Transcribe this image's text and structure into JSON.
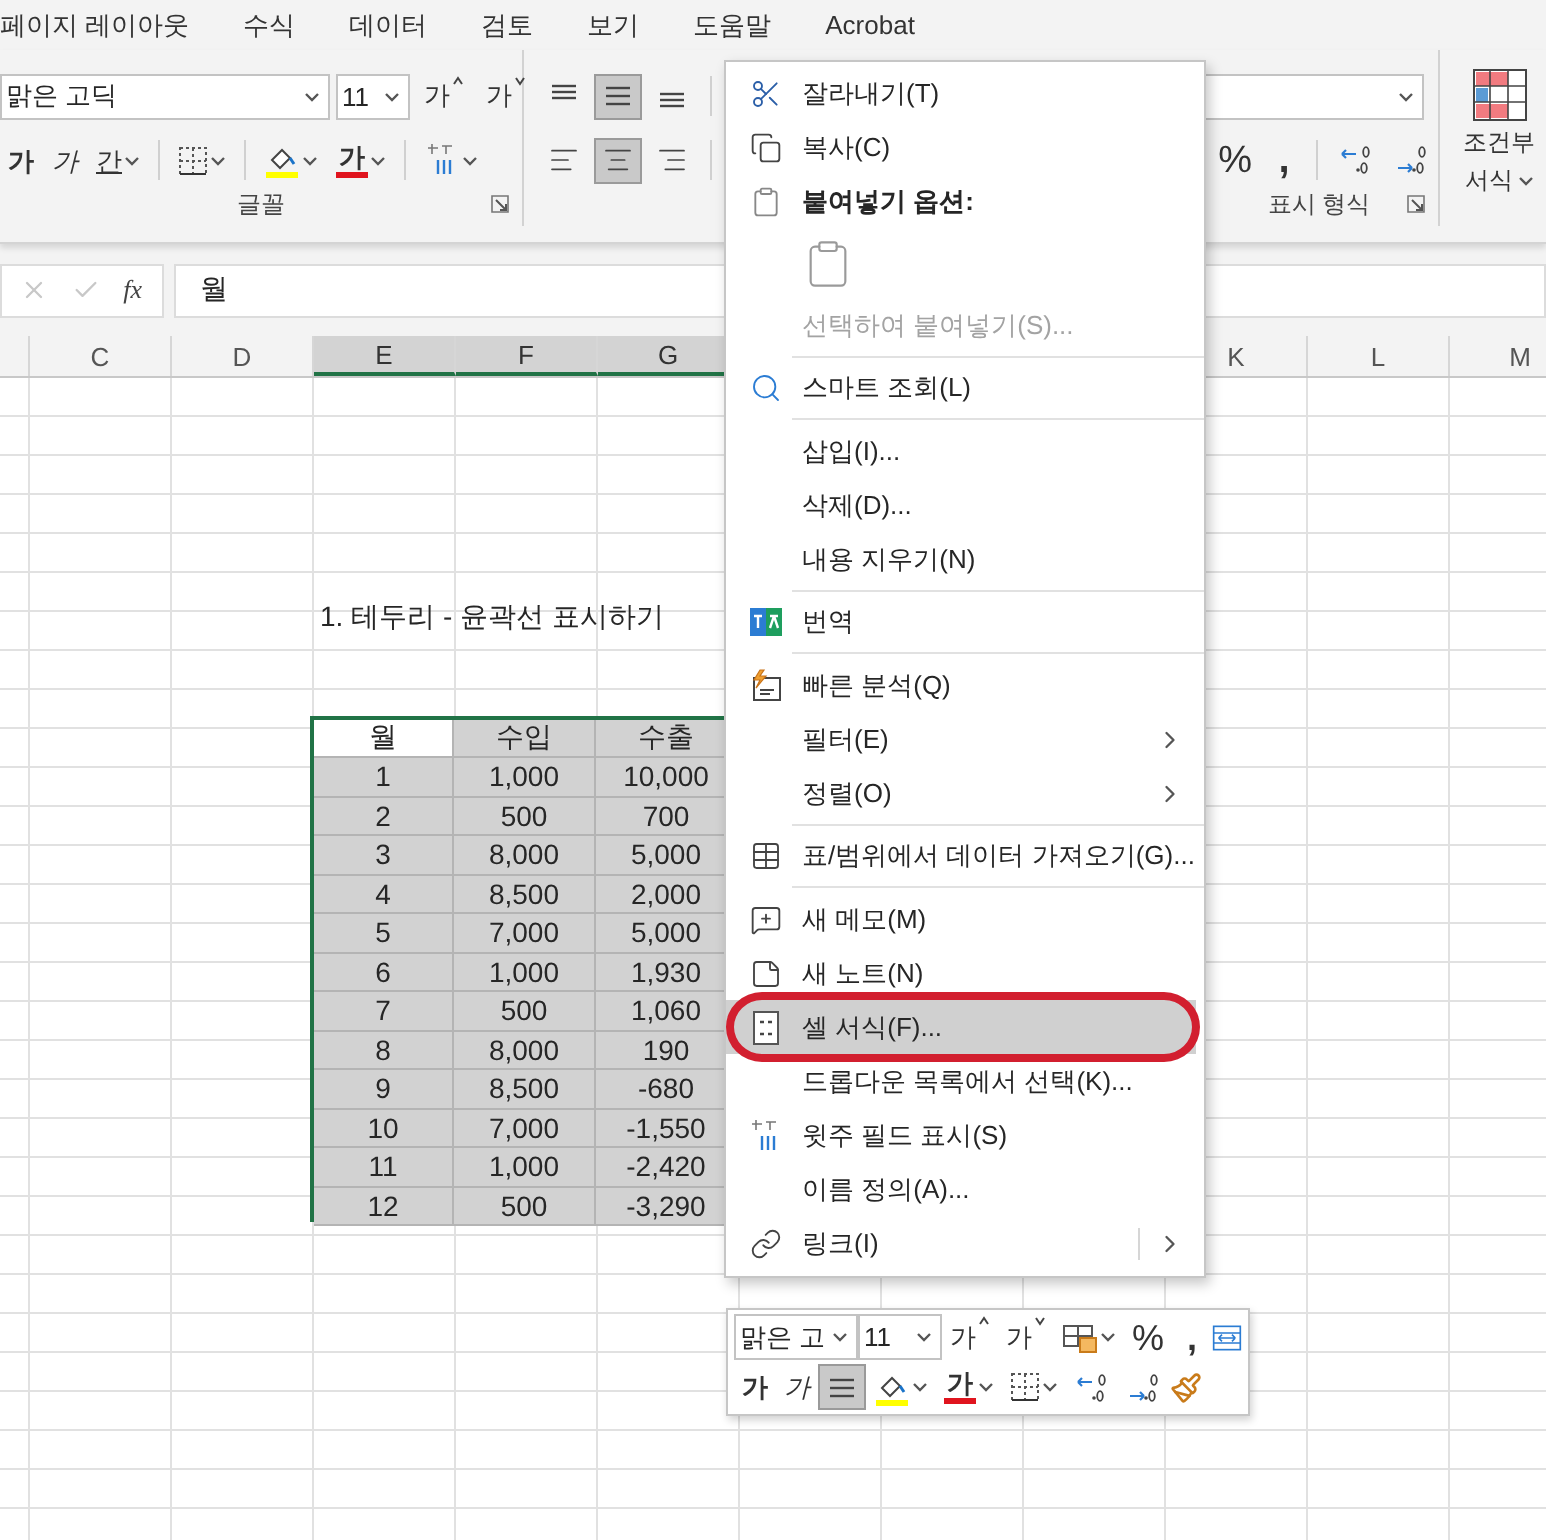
{
  "ribbon_tabs": [
    {
      "label": "페이지 레이아웃",
      "selected": false
    },
    {
      "label": "수식",
      "selected": false
    },
    {
      "label": "데이터",
      "selected": false
    },
    {
      "label": "검토",
      "selected": false
    },
    {
      "label": "보기",
      "selected": false
    },
    {
      "label": "도움말",
      "selected": false
    },
    {
      "label": "Acrobat",
      "selected": false
    }
  ],
  "font_group": {
    "label": "글꼴",
    "font_name": "맑은 고딕",
    "font_size": "11",
    "grow": "가",
    "shrink": "가",
    "bold": "가",
    "italic": "가",
    "underline": "간",
    "font_color": "가"
  },
  "alignment_group": {
    "vertical": [
      {
        "selected": false
      },
      {
        "selected": true
      },
      {
        "selected": false
      }
    ],
    "horizontal": [
      {
        "selected": false
      },
      {
        "selected": true
      },
      {
        "selected": false
      }
    ]
  },
  "number_group": {
    "label": "표시 형식",
    "percent": "%",
    "comma": ","
  },
  "conditional_format": {
    "label_line_1": "조건부",
    "label_line_2": "서식"
  },
  "formula_bar": {
    "function_label": "fx",
    "value": "월"
  },
  "columns": [
    {
      "label": "C",
      "selected": false
    },
    {
      "label": "D",
      "selected": false
    },
    {
      "label": "E",
      "selected": true
    },
    {
      "label": "F",
      "selected": true
    },
    {
      "label": "G",
      "selected": true
    },
    {
      "label": "K",
      "selected": false
    },
    {
      "label": "L",
      "selected": false
    },
    {
      "label": "M",
      "selected": false
    }
  ],
  "sheet_title": "1. 테두리 - 윤곽선 표시하기",
  "table": {
    "selected": true,
    "header": [
      {
        "text": "월",
        "active": true
      },
      {
        "text": "수입",
        "active": false
      },
      {
        "text": "수출",
        "active": false
      }
    ],
    "rows": [
      [
        "1",
        "1,000",
        "10,000"
      ],
      [
        "2",
        "500",
        "700"
      ],
      [
        "3",
        "8,000",
        "5,000"
      ],
      [
        "4",
        "8,500",
        "2,000"
      ],
      [
        "5",
        "7,000",
        "5,000"
      ],
      [
        "6",
        "1,000",
        "1,930"
      ],
      [
        "7",
        "500",
        "1,060"
      ],
      [
        "8",
        "8,000",
        "190"
      ],
      [
        "9",
        "8,500",
        "-680"
      ],
      [
        "10",
        "7,000",
        "-1,550"
      ],
      [
        "11",
        "1,000",
        "-2,420"
      ],
      [
        "12",
        "500",
        "-3,290"
      ]
    ]
  },
  "context_menu": [
    {
      "kind": "command",
      "label": "잘라내기(T)",
      "disabled": false,
      "highlighted": false,
      "circled": false,
      "submenu": false
    },
    {
      "kind": "command",
      "label": "복사(C)",
      "disabled": false,
      "highlighted": false,
      "circled": false,
      "submenu": false
    },
    {
      "kind": "heading",
      "label": "붙여넣기 옵션:"
    },
    {
      "kind": "paste-options"
    },
    {
      "kind": "command",
      "label": "선택하여 붙여넣기(S)...",
      "disabled": true,
      "highlighted": false,
      "circled": false,
      "submenu": false
    },
    {
      "kind": "separator"
    },
    {
      "kind": "command",
      "label": "스마트 조회(L)",
      "disabled": false,
      "highlighted": false,
      "circled": false,
      "submenu": false
    },
    {
      "kind": "separator"
    },
    {
      "kind": "command",
      "label": "삽입(I)...",
      "disabled": false,
      "highlighted": false,
      "circled": false,
      "submenu": false
    },
    {
      "kind": "command",
      "label": "삭제(D)...",
      "disabled": false,
      "highlighted": false,
      "circled": false,
      "submenu": false
    },
    {
      "kind": "command",
      "label": "내용 지우기(N)",
      "disabled": false,
      "highlighted": false,
      "circled": false,
      "submenu": false
    },
    {
      "kind": "separator"
    },
    {
      "kind": "command",
      "label": "번역",
      "disabled": false,
      "highlighted": false,
      "circled": false,
      "submenu": false
    },
    {
      "kind": "separator"
    },
    {
      "kind": "command",
      "label": "빠른 분석(Q)",
      "disabled": false,
      "highlighted": false,
      "circled": false,
      "submenu": false
    },
    {
      "kind": "command",
      "label": "필터(E)",
      "disabled": false,
      "highlighted": false,
      "circled": false,
      "submenu": true
    },
    {
      "kind": "command",
      "label": "정렬(O)",
      "disabled": false,
      "highlighted": false,
      "circled": false,
      "submenu": true
    },
    {
      "kind": "separator"
    },
    {
      "kind": "command",
      "label": "표/범위에서 데이터 가져오기(G)...",
      "disabled": false,
      "highlighted": false,
      "circled": false,
      "submenu": false
    },
    {
      "kind": "separator"
    },
    {
      "kind": "command",
      "label": "새 메모(M)",
      "disabled": false,
      "highlighted": false,
      "circled": false,
      "submenu": false
    },
    {
      "kind": "command",
      "label": "새 노트(N)",
      "disabled": false,
      "highlighted": false,
      "circled": false,
      "submenu": false
    },
    {
      "kind": "command",
      "label": "셀 서식(F)...",
      "disabled": false,
      "highlighted": true,
      "circled": true,
      "submenu": false
    },
    {
      "kind": "command",
      "label": "드롭다운 목록에서 선택(K)...",
      "disabled": false,
      "highlighted": false,
      "circled": false,
      "submenu": false
    },
    {
      "kind": "command",
      "label": "윗주 필드 표시(S)",
      "disabled": false,
      "highlighted": false,
      "circled": false,
      "submenu": false
    },
    {
      "kind": "command",
      "label": "이름 정의(A)...",
      "disabled": false,
      "highlighted": false,
      "circled": false,
      "submenu": false
    },
    {
      "kind": "command",
      "label": "링크(I)",
      "disabled": false,
      "highlighted": false,
      "circled": false,
      "submenu": true
    }
  ],
  "mini_toolbar": {
    "font_name": "맑은 고",
    "font_size": "11",
    "grow": "가",
    "shrink": "가",
    "percent": "%",
    "comma": ",",
    "bold": "가",
    "italic": "가",
    "font_color": "가",
    "center_selected": true
  }
}
